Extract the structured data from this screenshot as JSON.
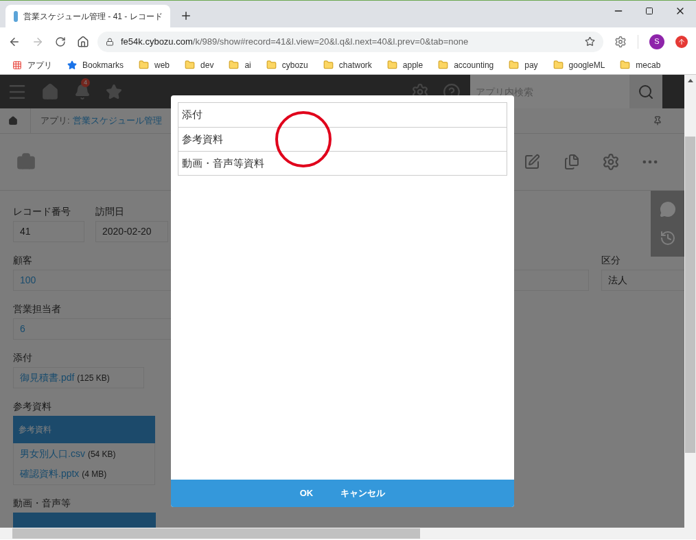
{
  "browser": {
    "tab_title": "営業スケジュール管理 - 41 - レコード",
    "url_host": "fe54k.cybozu.com",
    "url_path": "/k/989/show#record=41&l.view=20&l.q&l.next=40&l.prev=0&tab=none",
    "profile_initial": "S",
    "bookmarks": [
      {
        "kind": "apps",
        "label": "アプリ"
      },
      {
        "kind": "star",
        "label": "Bookmarks"
      },
      {
        "kind": "folder",
        "label": "web"
      },
      {
        "kind": "folder",
        "label": "dev"
      },
      {
        "kind": "folder",
        "label": "ai"
      },
      {
        "kind": "folder",
        "label": "cybozu"
      },
      {
        "kind": "folder",
        "label": "chatwork"
      },
      {
        "kind": "folder",
        "label": "apple"
      },
      {
        "kind": "folder",
        "label": "accounting"
      },
      {
        "kind": "folder",
        "label": "pay"
      },
      {
        "kind": "folder",
        "label": "googleML"
      },
      {
        "kind": "folder",
        "label": "mecab"
      }
    ]
  },
  "app_header": {
    "notification_count": "4",
    "search": {
      "placeholder": "アプリ内検索"
    }
  },
  "breadcrumb": {
    "prefix": "アプリ:",
    "app_name": "営業スケジュール管理"
  },
  "fields": {
    "record_number": {
      "label": "レコード番号",
      "value": "41"
    },
    "visit_date": {
      "label": "訪問日",
      "value": "2020-02-20"
    },
    "customer": {
      "label": "顧客",
      "value": "100"
    },
    "category": {
      "label": "区分",
      "value": "法人"
    },
    "sales_rep": {
      "label": "営業担当者",
      "value": "6"
    },
    "attachment": {
      "label": "添付",
      "files": [
        {
          "name": "御見積書.pdf",
          "size": "(125 KB)"
        }
      ]
    },
    "references": {
      "label": "参考資料",
      "table_header": "参考資料",
      "files": [
        {
          "name": "男女別人口.csv",
          "size": "(54 KB)"
        },
        {
          "name": "確認資料.pptx",
          "size": "(4 MB)"
        }
      ]
    },
    "media": {
      "label": "動画・音声等"
    }
  },
  "dialog": {
    "items": [
      {
        "label": "添付"
      },
      {
        "label": "参考資料"
      },
      {
        "label": "動画・音声等資料"
      }
    ],
    "ok": "OK",
    "cancel": "キャンセル"
  }
}
